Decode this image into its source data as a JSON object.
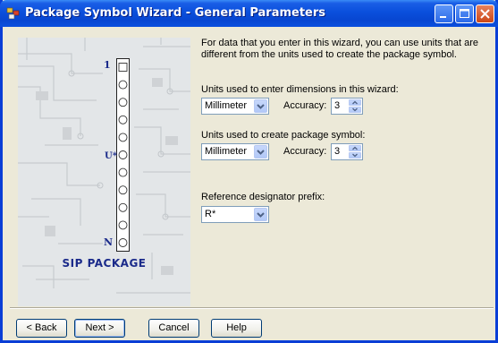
{
  "window": {
    "title": "Package Symbol Wizard - General Parameters",
    "title_icon": "wizard-app-icon",
    "controls": [
      "minimize",
      "maximize",
      "close"
    ]
  },
  "illustration": {
    "first_pin_label": "1",
    "last_pin_label": "N",
    "ref_label": "U*",
    "package_name": "SIP PACKAGE",
    "pin_count": 11
  },
  "description": "For data that you enter in this wizard, you can use units that are different from the units used to create the package symbol.",
  "dimensions": {
    "label": "Units used to enter dimensions in this wizard:",
    "unit_value": "Millimeter",
    "accuracy_label": "Accuracy:",
    "accuracy_value": "3"
  },
  "symbol": {
    "label": "Units used to create package symbol:",
    "unit_value": "Millimeter",
    "accuracy_label": "Accuracy:",
    "accuracy_value": "3"
  },
  "refdes": {
    "label": "Reference designator prefix:",
    "value": "R*"
  },
  "buttons": {
    "back": "< Back",
    "next": "Next >",
    "cancel": "Cancel",
    "help": "Help"
  },
  "colors": {
    "titlebar": "#0a4fdc",
    "window_bg": "#ece9d8",
    "label_blue": "#1a2a8a"
  }
}
